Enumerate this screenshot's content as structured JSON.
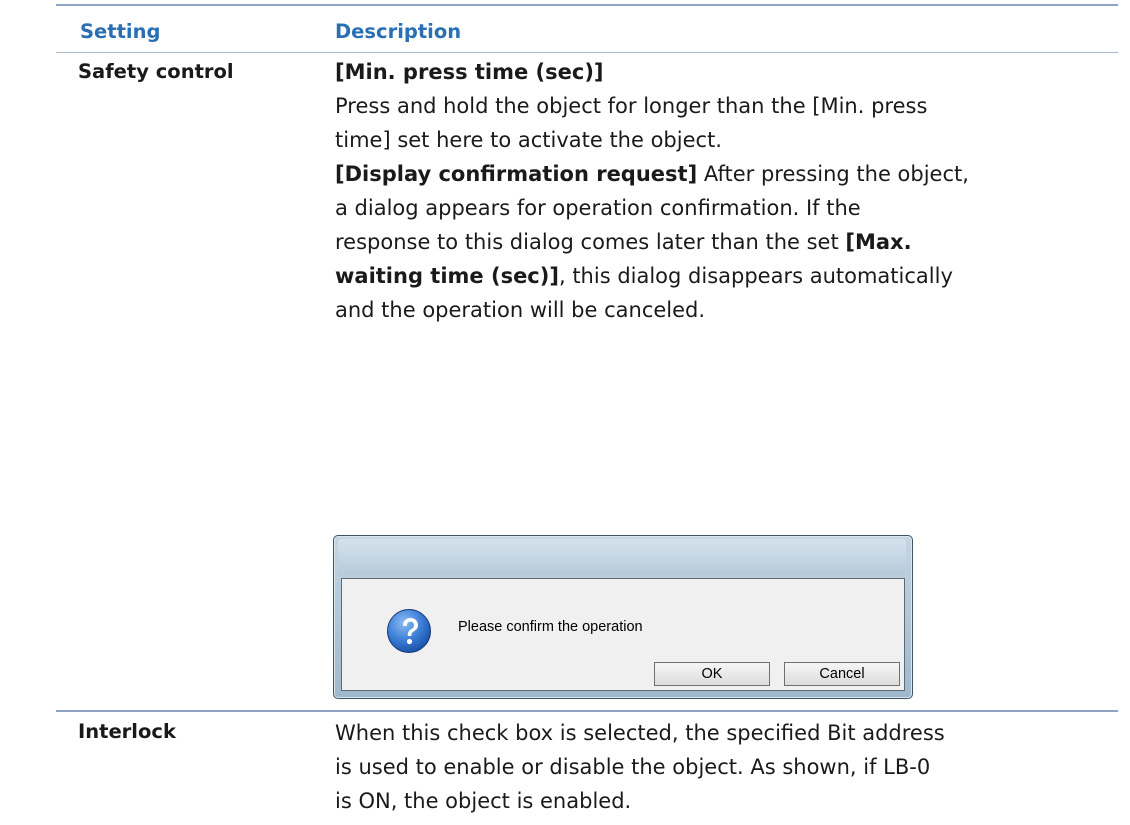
{
  "table": {
    "header": {
      "setting": "Setting",
      "description": "Description"
    },
    "rows": [
      {
        "setting": "Safety control",
        "lines": [
          [
            {
              "t": "[Min. press time (sec)]",
              "b": true
            }
          ],
          [
            {
              "t": "Press and hold the object for longer than the [Min. press",
              "b": false
            }
          ],
          [
            {
              "t": "time] set here to activate the object.",
              "b": false
            }
          ],
          [
            {
              "t": "[Display confirmation request]",
              "b": true
            },
            {
              "t": " After pressing the object,",
              "b": false
            }
          ],
          [
            {
              "t": "a dialog appears for operation confirmation. If the",
              "b": false
            }
          ],
          [
            {
              "t": "response to this dialog comes later than the set ",
              "b": false
            },
            {
              "t": "[Max.",
              "b": true
            }
          ],
          [
            {
              "t": "waiting time (sec)]",
              "b": true
            },
            {
              "t": ", this dialog disappears automatically",
              "b": false
            }
          ],
          [
            {
              "t": "and the operation will be canceled.",
              "b": false
            }
          ]
        ]
      },
      {
        "setting": "Interlock",
        "lines": [
          [
            {
              "t": "When this check box is selected, the specified Bit address",
              "b": false
            }
          ],
          [
            {
              "t": "is used to enable or disable the object. As shown, if LB-0",
              "b": false
            }
          ],
          [
            {
              "t": "is ON, the object is enabled.",
              "b": false
            }
          ]
        ]
      }
    ]
  },
  "dialog": {
    "icon": "question-icon",
    "message": "Please confirm the operation",
    "ok_label": "OK",
    "cancel_label": "Cancel"
  },
  "colors": {
    "header_text": "#2a6fb3",
    "rule": "#8ea4c4"
  }
}
